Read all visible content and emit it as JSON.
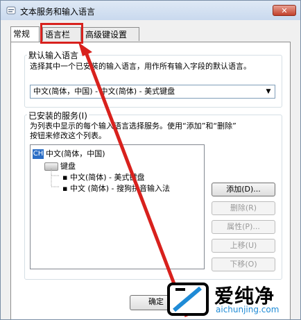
{
  "window": {
    "title": "文本服务和输入语言",
    "close_label": "✕"
  },
  "tabs": [
    {
      "label": "常规"
    },
    {
      "label": "语言栏"
    },
    {
      "label": "高级键设置"
    }
  ],
  "default_language": {
    "group_label": "默认输入语言",
    "description": "选择其中一个已安装的输入语言，用作所有输入字段的默认语言。",
    "selected": "中文(简体，中国) - 中文(简体) - 美式键盘"
  },
  "installed_services": {
    "group_label": "已安装的服务(I)",
    "description_line1": "为列表中显示的每个输入语言选择服务。使用“添加”和“删除”",
    "description_line2": "按钮来修改这个列表。",
    "tree": {
      "language": "中文(简体，中国)",
      "language_badge": "CH",
      "category": "键盘",
      "items": [
        "中文(简体) - 美式键盘",
        "中文 (简体) - 搜狗拼音输入法"
      ]
    },
    "buttons": {
      "add": "添加(D)...",
      "remove": "删除(R)",
      "properties": "属性(P)...",
      "move_up": "上移(U)",
      "move_down": "下移(O)"
    }
  },
  "footer": {
    "ok": "确定"
  },
  "watermark": {
    "text_cn": "爱纯净",
    "text_en": "aichunjing.com"
  },
  "colors": {
    "highlight": "#d8211d",
    "accent": "#2b6ec6",
    "watermark_blue": "#1f8bd6"
  }
}
